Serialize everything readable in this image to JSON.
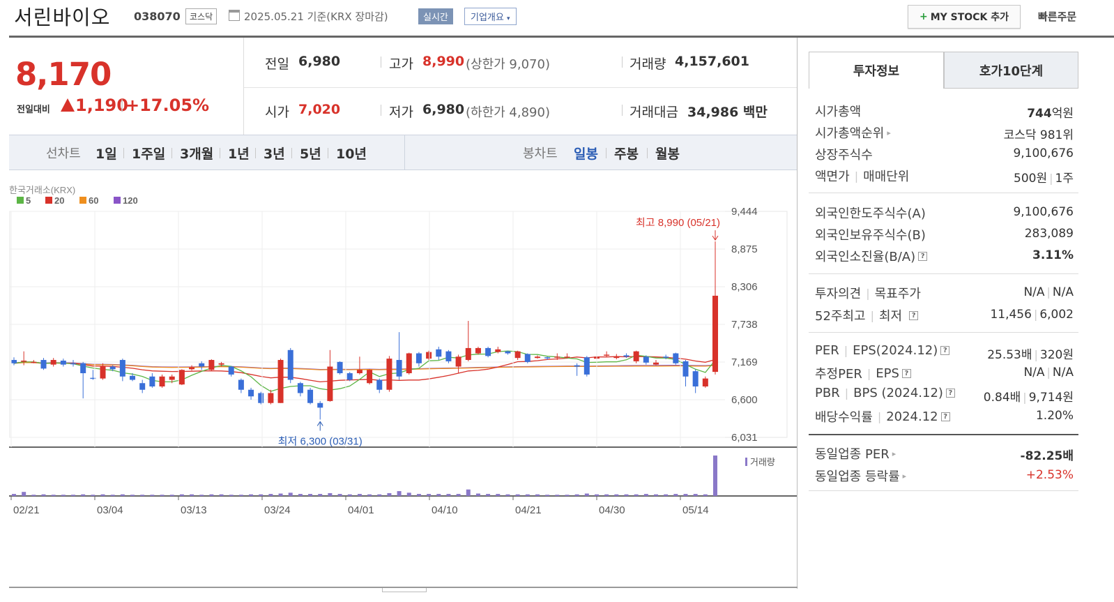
{
  "header": {
    "company_name": "서린바이오",
    "stock_code": "038070",
    "market": "코스닥",
    "base_date": "2025.05.21  기준(KRX 장마감)",
    "realtime": "실시간",
    "overview": "기업개요",
    "mystock": "MY STOCK 추가",
    "quick_order": "빠른주문"
  },
  "price": {
    "current": "8,170",
    "prev_diff_label": "전일대비",
    "change_amount": "1,190",
    "change_sep": "|",
    "change_rate": "+17.05%"
  },
  "stats": {
    "prev_label": "전일",
    "prev": "6,980",
    "high_label": "고가",
    "high": "8,990",
    "upper_limit": "(상한가 9,070)",
    "volume_label": "거래량",
    "volume": "4,157,601",
    "open_label": "시가",
    "open": "7,020",
    "low_label": "저가",
    "low": "6,980",
    "lower_limit": "(하한가 4,890)",
    "amount_label": "거래대금",
    "amount": "34,986 백만"
  },
  "period_bar": {
    "line_label": "선차트",
    "line_items": [
      "1일",
      "1주일",
      "3개월",
      "1년",
      "3년",
      "5년",
      "10년"
    ],
    "candle_label": "봉차트",
    "candle_items": [
      "일봉",
      "주봉",
      "월봉"
    ],
    "candle_active": "일봉"
  },
  "chart_data": {
    "type": "candlestick",
    "source_label": "한국거래소(KRX)",
    "legend": [
      {
        "name": "5",
        "color": "#5cb545"
      },
      {
        "name": "20",
        "color": "#d8322a"
      },
      {
        "name": "60",
        "color": "#ef8f1e"
      },
      {
        "name": "120",
        "color": "#8a55c8"
      }
    ],
    "y_ticks": [
      9444,
      8875,
      8306,
      7738,
      7169,
      6600,
      6031
    ],
    "ylim": [
      6031,
      9444
    ],
    "x_ticks": [
      "02/21",
      "03/04",
      "03/13",
      "03/24",
      "04/01",
      "04/10",
      "04/21",
      "04/30",
      "05/14"
    ],
    "high_annotation": "최고 8,990 (05/21)",
    "low_annotation": "최저 6,300 (03/31)",
    "volume_label": "거래량",
    "candles": [
      {
        "o": 7200,
        "c": 7150,
        "h": 7240,
        "l": 7120,
        "v": 0.05
      },
      {
        "o": 7180,
        "c": 7190,
        "h": 7330,
        "l": 7120,
        "v": 0.1
      },
      {
        "o": 7170,
        "c": 7170,
        "h": 7200,
        "l": 7150,
        "v": 0.03
      },
      {
        "o": 7200,
        "c": 7070,
        "h": 7230,
        "l": 7050,
        "v": 0.04
      },
      {
        "o": 7130,
        "c": 7200,
        "h": 7230,
        "l": 7100,
        "v": 0.03
      },
      {
        "o": 7190,
        "c": 7130,
        "h": 7220,
        "l": 7100,
        "v": 0.03
      },
      {
        "o": 7150,
        "c": 7140,
        "h": 7200,
        "l": 7100,
        "v": 0.03
      },
      {
        "o": 7150,
        "c": 7000,
        "h": 7170,
        "l": 6620,
        "v": 0.04
      },
      {
        "o": 6930,
        "c": 6920,
        "h": 7050,
        "l": 6900,
        "v": 0.03
      },
      {
        "o": 6920,
        "c": 7100,
        "h": 7150,
        "l": 6900,
        "v": 0.04
      },
      {
        "o": 7100,
        "c": 7060,
        "h": 7120,
        "l": 7030,
        "v": 0.03
      },
      {
        "o": 7200,
        "c": 6950,
        "h": 7220,
        "l": 6880,
        "v": 0.04
      },
      {
        "o": 6960,
        "c": 6900,
        "h": 7000,
        "l": 6880,
        "v": 0.03
      },
      {
        "o": 6850,
        "c": 6750,
        "h": 6900,
        "l": 6700,
        "v": 0.03
      },
      {
        "o": 6950,
        "c": 6800,
        "h": 7000,
        "l": 6780,
        "v": 0.03
      },
      {
        "o": 6800,
        "c": 6950,
        "h": 6980,
        "l": 6780,
        "v": 0.03
      },
      {
        "o": 6900,
        "c": 6950,
        "h": 6980,
        "l": 6850,
        "v": 0.03
      },
      {
        "o": 6830,
        "c": 7050,
        "h": 7060,
        "l": 6820,
        "v": 0.04
      },
      {
        "o": 7060,
        "c": 7090,
        "h": 7120,
        "l": 7040,
        "v": 0.04
      },
      {
        "o": 7150,
        "c": 7100,
        "h": 7180,
        "l": 7050,
        "v": 0.03
      },
      {
        "o": 7050,
        "c": 7200,
        "h": 7210,
        "l": 7030,
        "v": 0.04
      },
      {
        "o": 7130,
        "c": 7150,
        "h": 7170,
        "l": 7100,
        "v": 0.04
      },
      {
        "o": 7100,
        "c": 6980,
        "h": 7110,
        "l": 6950,
        "v": 0.03
      },
      {
        "o": 6900,
        "c": 6750,
        "h": 6920,
        "l": 6700,
        "v": 0.03
      },
      {
        "o": 6750,
        "c": 6650,
        "h": 6780,
        "l": 6600,
        "v": 0.04
      },
      {
        "o": 6700,
        "c": 6550,
        "h": 6720,
        "l": 6530,
        "v": 0.04
      },
      {
        "o": 6550,
        "c": 6700,
        "h": 6750,
        "l": 6530,
        "v": 0.05
      },
      {
        "o": 6550,
        "c": 7200,
        "h": 7220,
        "l": 6550,
        "v": 0.06
      },
      {
        "o": 7350,
        "c": 6900,
        "h": 7380,
        "l": 6850,
        "v": 0.08
      },
      {
        "o": 6850,
        "c": 6700,
        "h": 6870,
        "l": 6650,
        "v": 0.05
      },
      {
        "o": 6750,
        "c": 6550,
        "h": 6780,
        "l": 6530,
        "v": 0.05
      },
      {
        "o": 6550,
        "c": 6480,
        "h": 6580,
        "l": 6300,
        "v": 0.05
      },
      {
        "o": 6580,
        "c": 7100,
        "h": 7350,
        "l": 6570,
        "v": 0.07
      },
      {
        "o": 7170,
        "c": 7000,
        "h": 7180,
        "l": 6980,
        "v": 0.05
      },
      {
        "o": 7000,
        "c": 6900,
        "h": 7020,
        "l": 6880,
        "v": 0.04
      },
      {
        "o": 7000,
        "c": 7050,
        "h": 7250,
        "l": 6980,
        "v": 0.05
      },
      {
        "o": 6850,
        "c": 7050,
        "h": 7060,
        "l": 6830,
        "v": 0.04
      },
      {
        "o": 6900,
        "c": 6750,
        "h": 6920,
        "l": 6700,
        "v": 0.04
      },
      {
        "o": 6750,
        "c": 7220,
        "h": 7260,
        "l": 6720,
        "v": 0.07
      },
      {
        "o": 7200,
        "c": 6950,
        "h": 7620,
        "l": 6900,
        "v": 0.12
      },
      {
        "o": 7000,
        "c": 7300,
        "h": 7310,
        "l": 6980,
        "v": 0.08
      },
      {
        "o": 7300,
        "c": 7150,
        "h": 7320,
        "l": 7100,
        "v": 0.05
      },
      {
        "o": 7220,
        "c": 7320,
        "h": 7340,
        "l": 7200,
        "v": 0.05
      },
      {
        "o": 7360,
        "c": 7250,
        "h": 7400,
        "l": 7200,
        "v": 0.05
      },
      {
        "o": 7330,
        "c": 7180,
        "h": 7350,
        "l": 7150,
        "v": 0.05
      },
      {
        "o": 7100,
        "c": 7250,
        "h": 7280,
        "l": 7000,
        "v": 0.05
      },
      {
        "o": 7200,
        "c": 7380,
        "h": 7790,
        "l": 7180,
        "v": 0.16
      },
      {
        "o": 7300,
        "c": 7380,
        "h": 7400,
        "l": 7280,
        "v": 0.06
      },
      {
        "o": 7380,
        "c": 7260,
        "h": 7400,
        "l": 7240,
        "v": 0.05
      },
      {
        "o": 7320,
        "c": 7360,
        "h": 7400,
        "l": 7300,
        "v": 0.05
      },
      {
        "o": 7330,
        "c": 7300,
        "h": 7340,
        "l": 7280,
        "v": 0.04
      },
      {
        "o": 7230,
        "c": 7330,
        "h": 7340,
        "l": 7200,
        "v": 0.04
      },
      {
        "o": 7290,
        "c": 7170,
        "h": 7300,
        "l": 7150,
        "v": 0.04
      },
      {
        "o": 7230,
        "c": 7250,
        "h": 7270,
        "l": 7220,
        "v": 0.04
      },
      {
        "o": 7240,
        "c": 7230,
        "h": 7250,
        "l": 7200,
        "v": 0.03
      },
      {
        "o": 7250,
        "c": 7250,
        "h": 7300,
        "l": 7200,
        "v": 0.03
      },
      {
        "o": 7240,
        "c": 7250,
        "h": 7300,
        "l": 7220,
        "v": 0.03
      },
      {
        "o": 7120,
        "c": 7100,
        "h": 7150,
        "l": 6960,
        "v": 0.04
      },
      {
        "o": 7240,
        "c": 6980,
        "h": 7260,
        "l": 6950,
        "v": 0.06
      },
      {
        "o": 7220,
        "c": 7250,
        "h": 7300,
        "l": 7200,
        "v": 0.04
      },
      {
        "o": 7270,
        "c": 7280,
        "h": 7330,
        "l": 7240,
        "v": 0.04
      },
      {
        "o": 7230,
        "c": 7250,
        "h": 7290,
        "l": 7210,
        "v": 0.04
      },
      {
        "o": 7270,
        "c": 7250,
        "h": 7300,
        "l": 7230,
        "v": 0.04
      },
      {
        "o": 7180,
        "c": 7330,
        "h": 7340,
        "l": 7150,
        "v": 0.04
      },
      {
        "o": 7250,
        "c": 7160,
        "h": 7270,
        "l": 7130,
        "v": 0.05
      },
      {
        "o": 7130,
        "c": 7160,
        "h": 7200,
        "l": 7120,
        "v": 0.04
      },
      {
        "o": 7250,
        "c": 7240,
        "h": 7280,
        "l": 7210,
        "v": 0.04
      },
      {
        "o": 7300,
        "c": 7150,
        "h": 7310,
        "l": 7130,
        "v": 0.05
      },
      {
        "o": 7180,
        "c": 6950,
        "h": 7200,
        "l": 6800,
        "v": 0.05
      },
      {
        "o": 7030,
        "c": 6800,
        "h": 7060,
        "l": 6700,
        "v": 0.05
      },
      {
        "o": 6800,
        "c": 6920,
        "h": 6950,
        "l": 6780,
        "v": 0.04
      },
      {
        "o": 7020,
        "c": 8170,
        "h": 8990,
        "l": 6980,
        "v": 1.0
      }
    ]
  },
  "right_panel": {
    "tabs": [
      "투자정보",
      "호가10단계"
    ],
    "rows": [
      {
        "label": "시가총액",
        "value": "744",
        "unit": "억원"
      },
      {
        "label": "시가총액순위",
        "value": "코스닥 981위"
      },
      {
        "label": "상장주식수",
        "value": "9,100,676"
      },
      {
        "label": "액면가",
        "label2": "매매단위",
        "value": "500원",
        "value2": "1주"
      },
      {
        "label": "외국인한도주식수(A)",
        "value": "9,100,676"
      },
      {
        "label": "외국인보유주식수(B)",
        "value": "283,089"
      },
      {
        "label": "외국인소진율(B/A)",
        "value": "3.11%"
      },
      {
        "label": "투자의견",
        "label2": "목표주가",
        "value": "N/A",
        "value2": "N/A"
      },
      {
        "label": "52주최고",
        "label2": "최저",
        "value": "11,456",
        "value2": "6,002"
      },
      {
        "label": "PER",
        "label2": "EPS(2024.12)",
        "value": "25.53배",
        "value2": "320원"
      },
      {
        "label": "추정PER",
        "label2": "EPS",
        "value": "N/A",
        "value2": "N/A"
      },
      {
        "label": "PBR",
        "label2": "BPS (2024.12)",
        "value": "0.84배",
        "value2": "9,714원"
      },
      {
        "label": "배당수익률",
        "label2": "2024.12",
        "value": "1.20%"
      },
      {
        "label": "동일업종 PER",
        "value": "-82.25배"
      },
      {
        "label": "동일업종 등락률",
        "value": "+2.53%"
      }
    ],
    "help_glyph": "?"
  }
}
